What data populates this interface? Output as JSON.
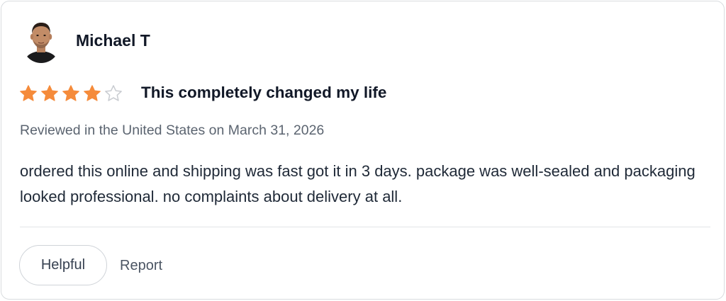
{
  "review": {
    "reviewer": {
      "name": "Michael T",
      "avatar_icon": "person-photo-icon"
    },
    "rating": {
      "value": 4,
      "max": 5,
      "filled_color": "#f58b3b",
      "empty_color": "#c9ccd1"
    },
    "title": "This completely changed my life",
    "meta": "Reviewed in the United States on March 31, 2026",
    "body": "ordered this online and shipping was fast got it in 3 days. package was well-sealed and packaging looked professional. no complaints about delivery at all.",
    "actions": {
      "helpful_label": "Helpful",
      "report_label": "Report"
    }
  }
}
